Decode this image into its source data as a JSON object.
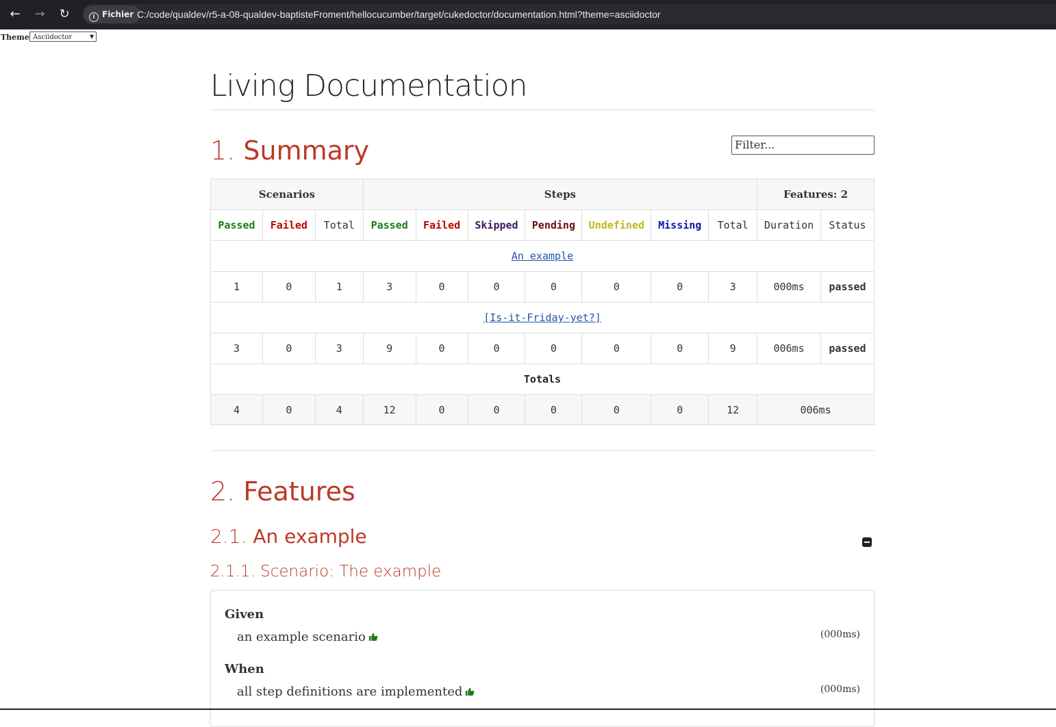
{
  "browser": {
    "chip_label": "Fichier",
    "url": "C:/code/qualdev/r5-a-08-qualdev-baptisteFroment/hellocucumber/target/cukedoctor/documentation.html?theme=asciidoctor"
  },
  "theme_selector": {
    "label": "Theme:",
    "value": "Asciidoctor"
  },
  "doc_title": "Living Documentation",
  "summary": {
    "num": "1.",
    "title": "Summary",
    "filter_placeholder": "Filter...",
    "group_headers": {
      "scenarios": "Scenarios",
      "steps": "Steps",
      "features": "Features: 2"
    },
    "columns": [
      "Passed",
      "Failed",
      "Total",
      "Passed",
      "Failed",
      "Skipped",
      "Pending",
      "Undefined",
      "Missing",
      "Total",
      "Duration",
      "Status"
    ],
    "features": [
      {
        "name": "An example",
        "values": [
          "1",
          "0",
          "1",
          "3",
          "0",
          "0",
          "0",
          "0",
          "0",
          "3",
          "000ms"
        ],
        "status": "passed"
      },
      {
        "name": "[Is-it-Friday-yet?]",
        "values": [
          "3",
          "0",
          "3",
          "9",
          "0",
          "0",
          "0",
          "0",
          "0",
          "9",
          "006ms"
        ],
        "status": "passed"
      }
    ],
    "totals_label": "Totals",
    "totals": [
      "4",
      "0",
      "4",
      "12",
      "0",
      "0",
      "0",
      "0",
      "0",
      "12",
      "006ms"
    ]
  },
  "features_section": {
    "num": "2.",
    "title": "Features",
    "feature": {
      "num": "2.1.",
      "title": "An example"
    },
    "scenario": {
      "num": "2.1.1.",
      "title": "Scenario: The example"
    },
    "steps": [
      {
        "keyword": "Given",
        "text": "an example scenario",
        "duration": "(000ms)"
      },
      {
        "keyword": "When",
        "text": "all step definitions are implemented",
        "duration": "(000ms)"
      }
    ]
  },
  "colors": {
    "heading": "#ba3925",
    "passed": "#1b7b1b",
    "failed": "#bb0000",
    "link": "#2156a5",
    "undefined": "#c4b41a",
    "missing": "#0a1aa8"
  }
}
